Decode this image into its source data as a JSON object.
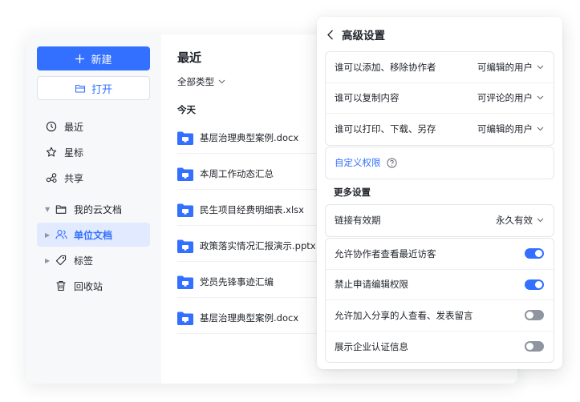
{
  "sidebar": {
    "new_label": "新建",
    "open_label": "打开",
    "items": [
      {
        "label": "最近",
        "icon": "clock-icon"
      },
      {
        "label": "星标",
        "icon": "star-icon"
      },
      {
        "label": "共享",
        "icon": "share-icon"
      },
      {
        "label": "我的云文档",
        "icon": "folder-icon"
      },
      {
        "label": "单位文档",
        "icon": "users-icon"
      },
      {
        "label": "标签",
        "icon": "tag-icon"
      },
      {
        "label": "回收站",
        "icon": "trash-icon"
      }
    ]
  },
  "main": {
    "title": "最近",
    "filter_label": "全部类型",
    "section_label": "今天",
    "files": [
      "基层治理典型案例.docx",
      "本周工作动态汇总",
      "民生项目经费明细表.xlsx",
      "政策落实情况汇报演示.pptx",
      "党员先锋事迹汇编",
      "基层治理典型案例.docx"
    ]
  },
  "panel": {
    "title": "高级设置",
    "permissions": [
      {
        "label": "谁可以添加、移除协作者",
        "value": "可编辑的用户"
      },
      {
        "label": "谁可以复制内容",
        "value": "可评论的用户"
      },
      {
        "label": "谁可以打印、下载、另存",
        "value": "可编辑的用户"
      }
    ],
    "custom_label": "自定义权限",
    "more_title": "更多设置",
    "link_validity": {
      "label": "链接有效期",
      "value": "永久有效"
    },
    "toggles": [
      {
        "label": "允许协作者查看最近访客",
        "on": true
      },
      {
        "label": "禁止申请编辑权限",
        "on": true
      },
      {
        "label": "允许加入分享的人查看、发表留言",
        "on": false
      },
      {
        "label": "展示企业认证信息",
        "on": false
      }
    ]
  },
  "colors": {
    "accent": "#3370ff",
    "toggle_off": "#8f959e",
    "active_bg": "#e1eaff"
  }
}
